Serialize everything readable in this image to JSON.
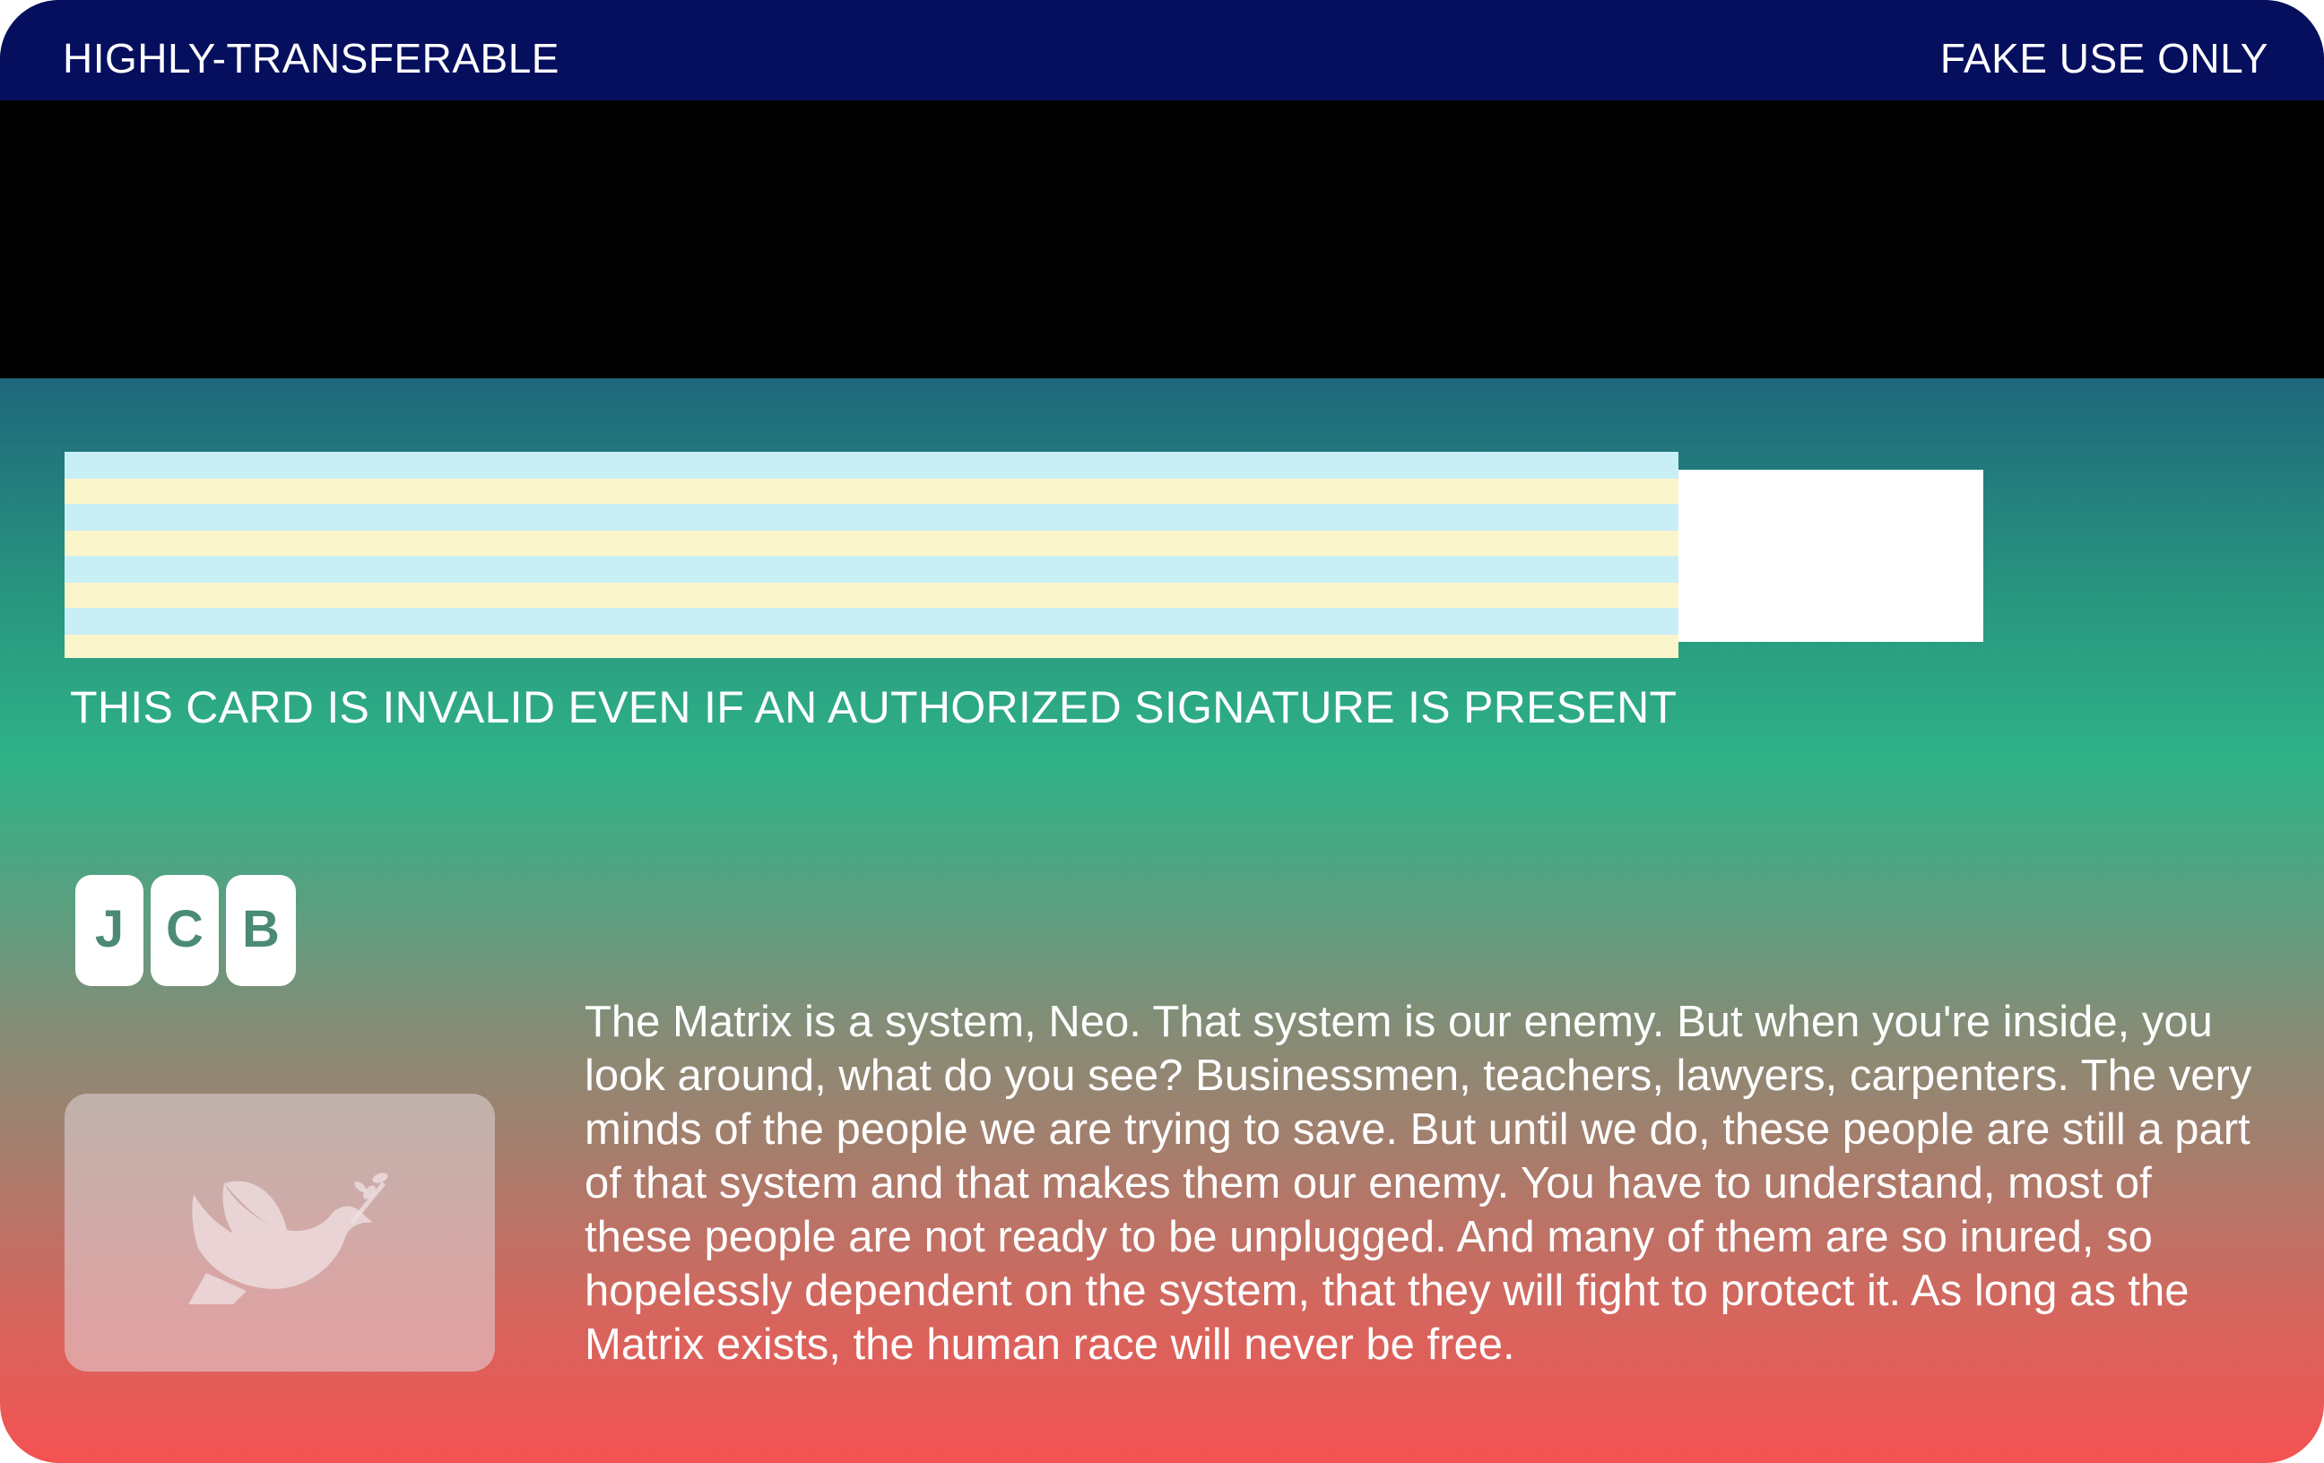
{
  "header": {
    "left_label": "HIGHLY-TRANSFERABLE",
    "right_label": "FAKE USE ONLY"
  },
  "signature_panel": {
    "disclaimer": "THIS CARD IS INVALID EVEN IF AN AUTHORIZED SIGNATURE IS PRESENT"
  },
  "brand": {
    "logo_letters": [
      "J",
      "C",
      "B"
    ],
    "icon": "jcb-logo"
  },
  "hologram": {
    "icon": "dove-with-olive-branch-icon"
  },
  "quote": {
    "text": "The Matrix is a system, Neo. That system is our enemy. But when you're inside, you look around, what do you see? Businessmen, teachers, lawyers, carpenters. The very minds of the people we are trying to save. But until we do, these people are still a part of that system and that makes them our enemy. You have to understand, most of these people are not ready to be unplugged. And many of them are so inured, so hopelessly dependent on the system, that they will fight to protect it. As long as the Matrix exists, the human race will never be free."
  },
  "colors": {
    "top_band": "#060f5e",
    "gradient_bottom": "#f45252",
    "gradient_mid": "#2fb287",
    "stripe_blue": "#c9eff6",
    "stripe_yellow": "#fbf5cb"
  }
}
